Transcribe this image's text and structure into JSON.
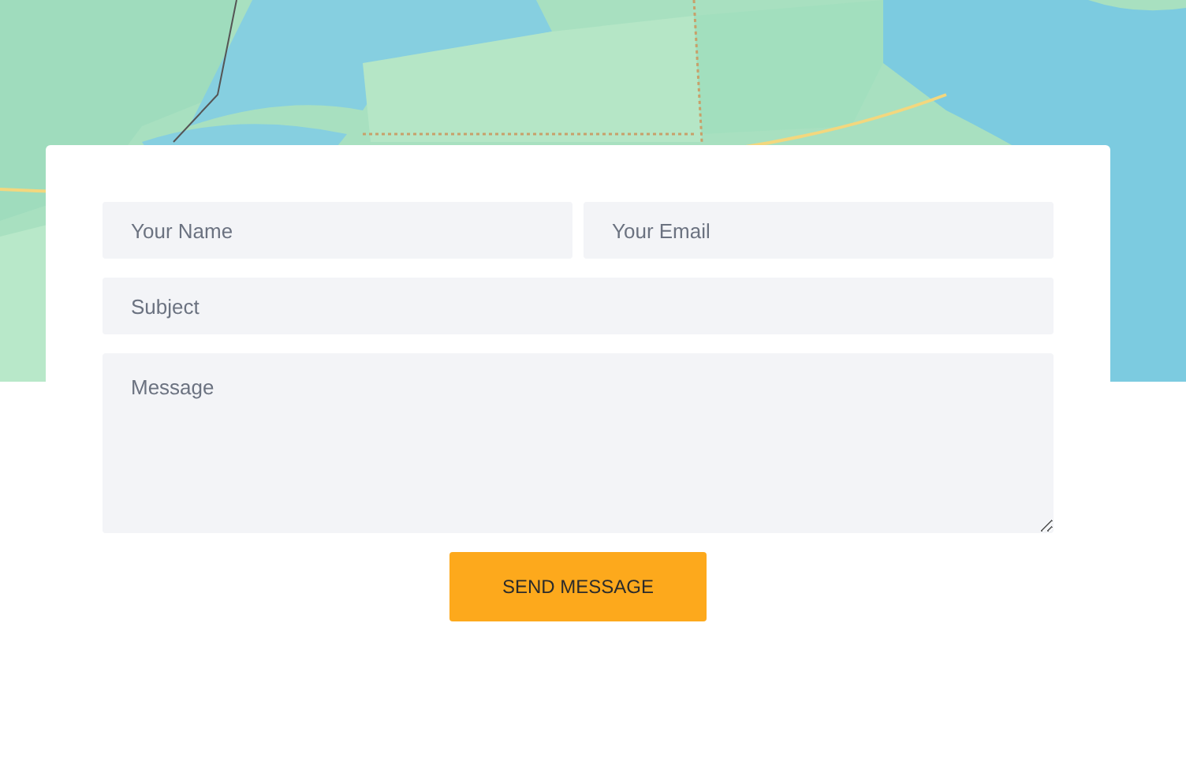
{
  "form": {
    "name_field": {
      "placeholder": "Your Name"
    },
    "email_field": {
      "placeholder": "Your Email"
    },
    "subject_field": {
      "placeholder": "Subject"
    },
    "message_field": {
      "placeholder": "Message"
    },
    "submit_button": {
      "label": "SEND MESSAGE"
    }
  }
}
